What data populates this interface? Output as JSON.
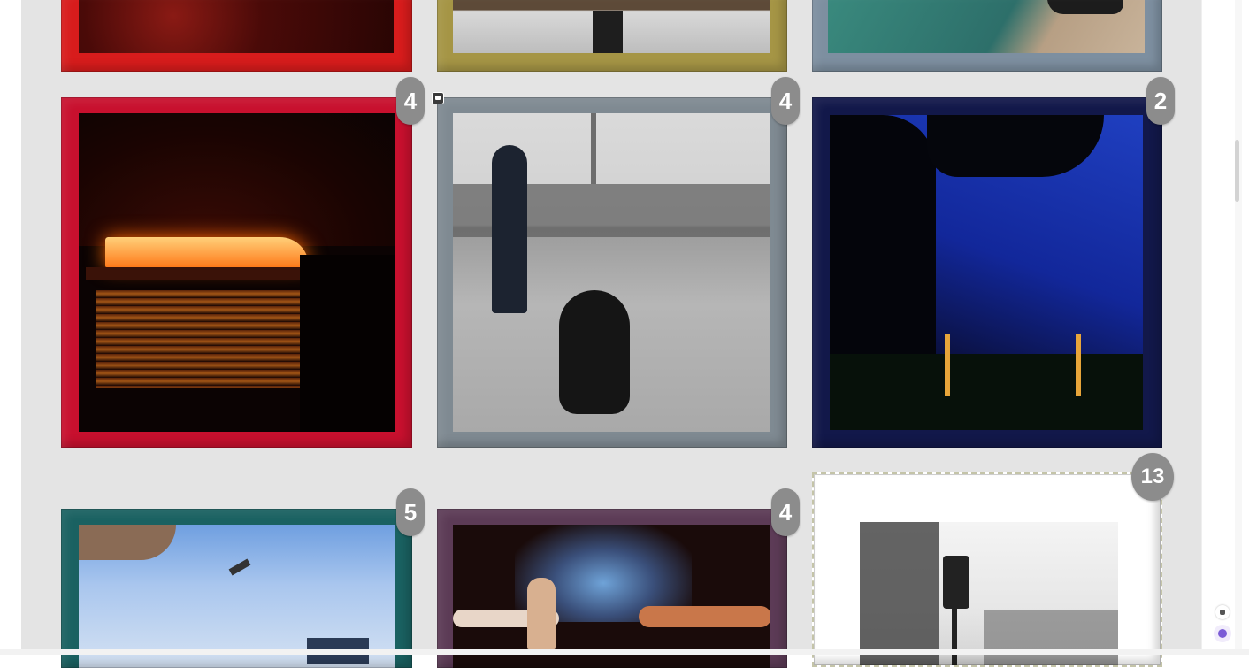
{
  "gallery": {
    "items": [
      {
        "badge": "",
        "frame_color": "#d81c1c"
      },
      {
        "badge": "",
        "frame_color": "#a59545"
      },
      {
        "badge": "",
        "frame_color": "#7d8fa0"
      },
      {
        "badge": "4",
        "frame_color": "#c8102e"
      },
      {
        "badge": "4",
        "frame_color": "#7f8a92"
      },
      {
        "badge": "2",
        "frame_color": "#12184a"
      },
      {
        "badge": "5",
        "frame_color": "#1a6161"
      },
      {
        "badge": "4",
        "frame_color": "#5c3b56"
      },
      {
        "badge": "13",
        "frame_color": "#ffffff"
      }
    ]
  },
  "icons": {
    "photo_overlay": "photo-icon",
    "floating_top": "small-square-icon",
    "floating_bottom": "assistant-icon"
  },
  "colors": {
    "page_background": "#e4e4e4",
    "badge_background": "#8c8c8c"
  }
}
